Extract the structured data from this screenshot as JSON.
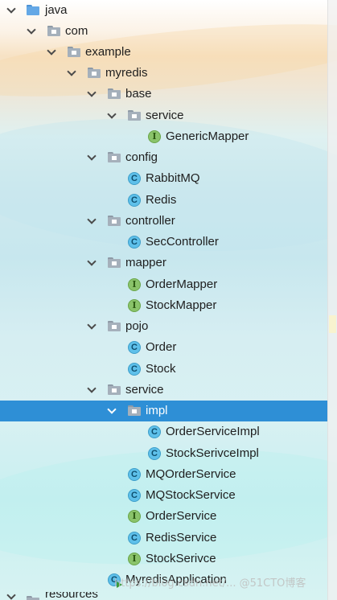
{
  "tree": {
    "nodes": [
      {
        "label": "java",
        "type": "folder-source",
        "expanded": true
      },
      {
        "label": "com",
        "type": "package",
        "expanded": true
      },
      {
        "label": "example",
        "type": "package",
        "expanded": true
      },
      {
        "label": "myredis",
        "type": "package",
        "expanded": true
      },
      {
        "label": "base",
        "type": "package",
        "expanded": true
      },
      {
        "label": "service",
        "type": "package",
        "expanded": true
      },
      {
        "label": "GenericMapper",
        "type": "interface"
      },
      {
        "label": "config",
        "type": "package",
        "expanded": true
      },
      {
        "label": "RabbitMQ",
        "type": "class"
      },
      {
        "label": "Redis",
        "type": "class"
      },
      {
        "label": "controller",
        "type": "package",
        "expanded": true
      },
      {
        "label": "SecController",
        "type": "class"
      },
      {
        "label": "mapper",
        "type": "package",
        "expanded": true
      },
      {
        "label": "OrderMapper",
        "type": "interface"
      },
      {
        "label": "StockMapper",
        "type": "interface"
      },
      {
        "label": "pojo",
        "type": "package",
        "expanded": true
      },
      {
        "label": "Order",
        "type": "class"
      },
      {
        "label": "Stock",
        "type": "class"
      },
      {
        "label": "service",
        "type": "package",
        "expanded": true
      },
      {
        "label": "impl",
        "type": "package",
        "expanded": true,
        "selected": true
      },
      {
        "label": "OrderServiceImpl",
        "type": "class"
      },
      {
        "label": "StockSerivceImpl",
        "type": "class"
      },
      {
        "label": "MQOrderService",
        "type": "class"
      },
      {
        "label": "MQStockService",
        "type": "class"
      },
      {
        "label": "OrderService",
        "type": "interface"
      },
      {
        "label": "RedisService",
        "type": "class"
      },
      {
        "label": "StockSerivce",
        "type": "interface"
      },
      {
        "label": "MyredisApplication",
        "type": "class-runnable"
      }
    ],
    "partial_bottom_label": "resources"
  },
  "watermark": "https://blog.csdn.net/... @51CTO博客",
  "colors": {
    "selection": "#2e8fd6",
    "class_badge": "#5ec0ea",
    "interface_badge": "#8ac36a",
    "package_folder": "#a5b0bb",
    "source_folder": "#64a8e6"
  }
}
